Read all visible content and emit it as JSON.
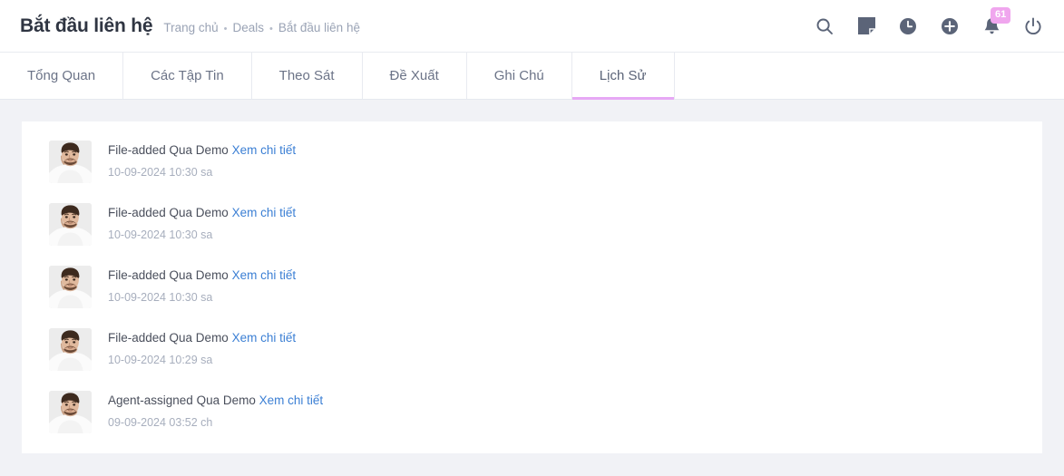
{
  "header": {
    "page_title": "Bắt đầu liên hệ",
    "breadcrumb": [
      {
        "label": "Trang chủ"
      },
      {
        "label": "Deals"
      },
      {
        "label": "Bắt đầu liên hệ"
      }
    ],
    "separator": "•",
    "icons": [
      {
        "name": "search-icon",
        "label": "Tìm kiếm"
      },
      {
        "name": "note-icon",
        "label": "Ghi chú"
      },
      {
        "name": "clock-icon",
        "label": "Lịch sử"
      },
      {
        "name": "plus-circle-icon",
        "label": "Thêm mới"
      },
      {
        "name": "bell-icon",
        "label": "Thông báo"
      },
      {
        "name": "power-icon",
        "label": "Đăng xuất"
      }
    ],
    "notification_badge": "61",
    "badge_color": "#f0a6ee"
  },
  "tabs": {
    "active_index": 5,
    "accent_color": "#e6a8f5",
    "items": [
      {
        "label": "Tổng Quan"
      },
      {
        "label": "Các Tập Tin"
      },
      {
        "label": "Theo Sát"
      },
      {
        "label": "Đề Xuất"
      },
      {
        "label": "Ghi Chú"
      },
      {
        "label": "Lịch Sử"
      }
    ]
  },
  "activity": {
    "link_label": "Xem chi tiết",
    "link_color": "#3b7fd4",
    "rows": [
      {
        "action": "File-added Qua Demo",
        "link": "Xem chi tiết",
        "time": "10-09-2024 10:30 sa"
      },
      {
        "action": "File-added Qua Demo",
        "link": "Xem chi tiết",
        "time": "10-09-2024 10:30 sa"
      },
      {
        "action": "File-added Qua Demo",
        "link": "Xem chi tiết",
        "time": "10-09-2024 10:30 sa"
      },
      {
        "action": "File-added Qua Demo",
        "link": "Xem chi tiết",
        "time": "10-09-2024 10:29 sa"
      },
      {
        "action": "Agent-assigned Qua Demo",
        "link": "Xem chi tiết",
        "time": "09-09-2024 03:52 ch"
      }
    ]
  }
}
